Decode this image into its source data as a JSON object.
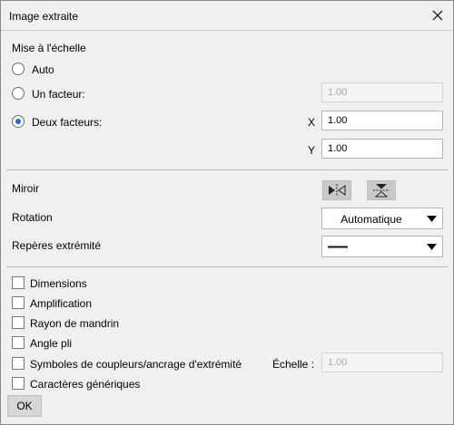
{
  "window": {
    "title": "Image extraite"
  },
  "scaling": {
    "section_label": "Mise à l'échelle",
    "options": [
      {
        "label": "Auto",
        "selected": false
      },
      {
        "label": "Un facteur:",
        "selected": false
      },
      {
        "label": "Deux facteurs:",
        "selected": true
      }
    ],
    "single_factor_value": "1.00",
    "x_label": "X",
    "x_value": "1.00",
    "y_label": "Y",
    "y_value": "1.00"
  },
  "options": {
    "mirror_label": "Miroir",
    "mirror_icons": [
      "mirror-horizontal-icon",
      "mirror-vertical-icon"
    ],
    "rotation_label": "Rotation",
    "rotation_value": "Automatique",
    "end_marks_label": "Repères extrémité",
    "end_marks_value": "line-style-solid"
  },
  "checkboxes": [
    {
      "label": "Dimensions",
      "checked": false
    },
    {
      "label": "Amplification",
      "checked": false
    },
    {
      "label": "Rayon de mandrin",
      "checked": false
    },
    {
      "label": "Angle pli",
      "checked": false
    },
    {
      "label": "Symboles de coupleurs/ancrage d'extrémité",
      "checked": false
    },
    {
      "label": "Caractères génériques",
      "checked": false
    }
  ],
  "scale_field": {
    "label": "Échelle :",
    "value": "1.00"
  },
  "buttons": {
    "ok_label": "OK"
  },
  "colors": {
    "accent": "#1f6ad4",
    "background": "#f0f0f0",
    "icon_button": "#c9c9c9"
  }
}
